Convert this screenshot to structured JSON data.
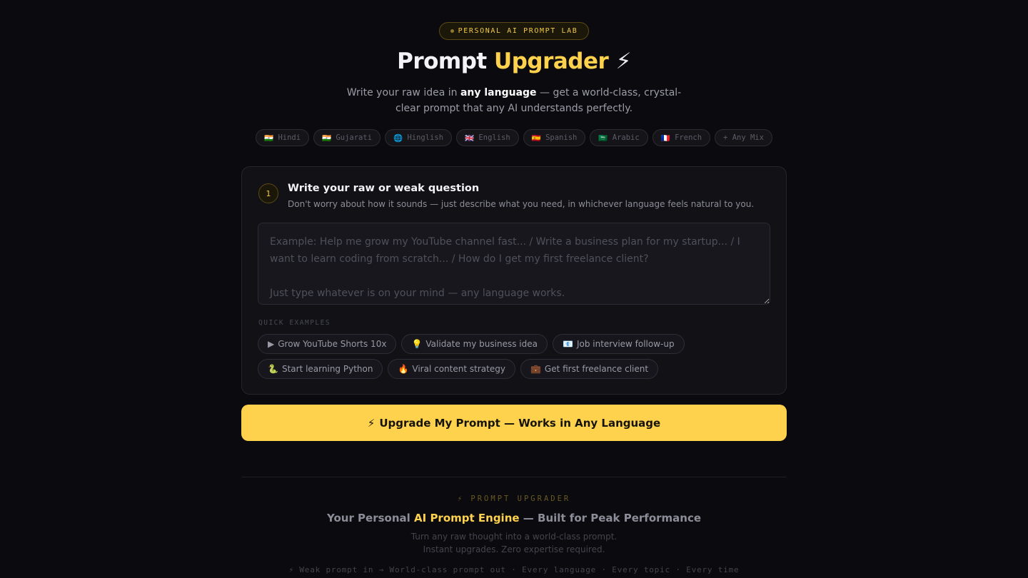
{
  "header": {
    "badge": "PERSONAL AI PROMPT LAB",
    "title_plain": "Prompt",
    "title_accent": "Upgrader",
    "title_emoji": "⚡",
    "subtitle_before": "Write your raw idea in ",
    "subtitle_bold": "any language",
    "subtitle_after": " — get a world-class, crystal-clear prompt that any AI understands perfectly."
  },
  "languages": [
    {
      "flag": "🇮🇳",
      "label": "Hindi"
    },
    {
      "flag": "🇮🇳",
      "label": "Gujarati"
    },
    {
      "flag": "🌐",
      "label": "Hinglish"
    },
    {
      "flag": "🇬🇧",
      "label": "English"
    },
    {
      "flag": "🇪🇸",
      "label": "Spanish"
    },
    {
      "flag": "🇸🇦",
      "label": "Arabic"
    },
    {
      "flag": "🇫🇷",
      "label": "French"
    },
    {
      "flag": "",
      "label": "+ Any Mix"
    }
  ],
  "step": {
    "number": "1",
    "title": "Write your raw or weak question",
    "description": "Don't worry about how it sounds — just describe what you need, in whichever language feels natural to you.",
    "placeholder": "Example: Help me grow my YouTube channel fast... / Write a business plan for my startup... / I want to learn coding from scratch... / How do I get my first freelance client?\n\nJust type whatever is on your mind — any language works.",
    "value": ""
  },
  "quick_examples": {
    "label": "QUICK EXAMPLES",
    "items": [
      {
        "icon": "▶",
        "label": "Grow YouTube Shorts 10x"
      },
      {
        "icon": "💡",
        "label": "Validate my business idea"
      },
      {
        "icon": "📧",
        "label": "Job interview follow-up"
      },
      {
        "icon": "🐍",
        "label": "Start learning Python"
      },
      {
        "icon": "🔥",
        "label": "Viral content strategy"
      },
      {
        "icon": "💼",
        "label": "Get first freelance client"
      }
    ]
  },
  "action": {
    "icon": "⚡",
    "label": "Upgrade My Prompt — Works in Any Language"
  },
  "footer": {
    "tag": "⚡ PROMPT UPGRADER",
    "title_before": "Your Personal ",
    "title_accent": "AI Prompt Engine",
    "title_after": " — Built for Peak Performance",
    "desc_line1": "Turn any raw thought into a world-class prompt.",
    "desc_line2": "Instant upgrades. Zero expertise required.",
    "tagline": "⚡ Weak prompt in → World-class prompt out · Every language · Every topic · Every time"
  },
  "colors": {
    "accent": "#ffd24d",
    "background": "#0b0b0f",
    "card": "#111116"
  }
}
